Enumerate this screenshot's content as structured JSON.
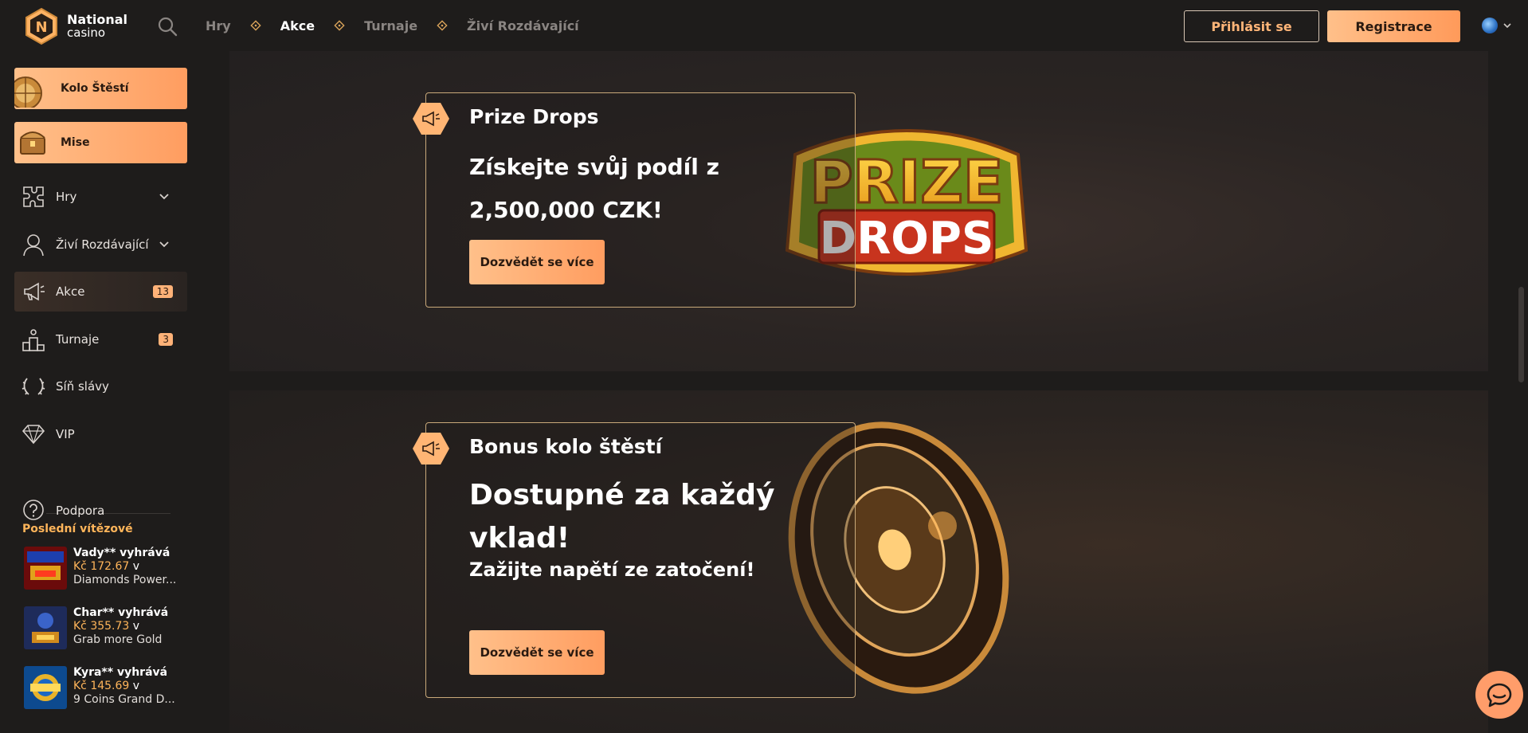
{
  "brand": {
    "name_line1": "National",
    "name_line2": "casino",
    "badge_letter": "N"
  },
  "topnav": {
    "items": [
      "Hry",
      "Akce",
      "Turnaje",
      "Živí Rozdávající"
    ]
  },
  "header": {
    "login": "Přihlásit se",
    "register": "Registrace"
  },
  "sidebar": {
    "promo": [
      {
        "label": "Kolo Štěstí"
      },
      {
        "label": "Mise"
      }
    ],
    "items": [
      {
        "label": "Hry"
      },
      {
        "label": "Živí Rozdávající"
      },
      {
        "label": "Akce",
        "badge": "13"
      },
      {
        "label": "Turnaje",
        "badge": "3"
      },
      {
        "label": "Síň slávy"
      },
      {
        "label": "VIP"
      },
      {
        "label": "Podpora"
      }
    ],
    "winners_title": "Poslední vítězové",
    "winners": [
      {
        "name": "Vady** vyhrává",
        "amount": "Kč 172.67",
        "in": "v",
        "game": "Diamonds Power..."
      },
      {
        "name": "Char** vyhrává",
        "amount": "Kč 355.73",
        "in": "v",
        "game": "Grab more Gold"
      },
      {
        "name": "Kyra** vyhrává",
        "amount": "Kč 145.69",
        "in": "v",
        "game": "9 Coins Grand D..."
      }
    ]
  },
  "promotions": [
    {
      "title": "Prize Drops",
      "headline_1": "Získejte svůj podíl z",
      "headline_2": "2,500,000 CZK!",
      "button": "Dozvědět se více",
      "art_line1": "PRIZE",
      "art_line2": "DROPS"
    },
    {
      "title": "Bonus kolo štěstí",
      "headline_1": "Dostupné za každý",
      "headline_2": "vklad!",
      "subline": "Zažijte napětí ze zatočení!",
      "button": "Dozvědět se více"
    }
  ]
}
